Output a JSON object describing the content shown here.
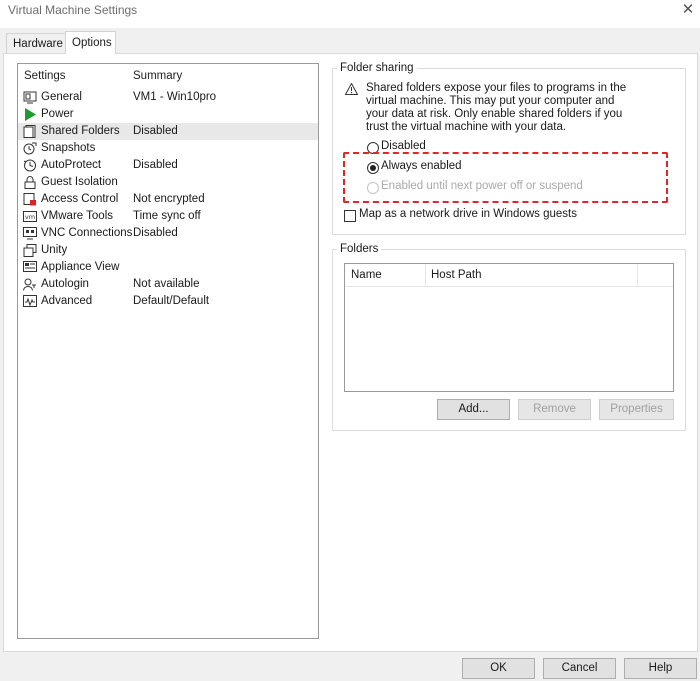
{
  "window": {
    "title": "Virtual Machine Settings"
  },
  "tabs": [
    {
      "label": "Hardware"
    },
    {
      "label": "Options"
    }
  ],
  "settings": {
    "header_settings": "Settings",
    "header_summary": "Summary",
    "items": [
      {
        "name": "General",
        "summary": "VM1 - Win10pro",
        "icon": "general-icon"
      },
      {
        "name": "Power",
        "summary": "",
        "icon": "power-icon"
      },
      {
        "name": "Shared Folders",
        "summary": "Disabled",
        "icon": "shared-folders-icon"
      },
      {
        "name": "Snapshots",
        "summary": "",
        "icon": "snapshots-icon"
      },
      {
        "name": "AutoProtect",
        "summary": "Disabled",
        "icon": "autoprotect-icon"
      },
      {
        "name": "Guest Isolation",
        "summary": "",
        "icon": "lock-icon"
      },
      {
        "name": "Access Control",
        "summary": "Not encrypted",
        "icon": "access-control-icon"
      },
      {
        "name": "VMware Tools",
        "summary": "Time sync off",
        "icon": "vmware-tools-icon"
      },
      {
        "name": "VNC Connections",
        "summary": "Disabled",
        "icon": "vnc-icon"
      },
      {
        "name": "Unity",
        "summary": "",
        "icon": "unity-icon"
      },
      {
        "name": "Appliance View",
        "summary": "",
        "icon": "appliance-view-icon"
      },
      {
        "name": "Autologin",
        "summary": "Not available",
        "icon": "autologin-icon"
      },
      {
        "name": "Advanced",
        "summary": "Default/Default",
        "icon": "advanced-icon"
      }
    ]
  },
  "folder_sharing": {
    "label": "Folder sharing",
    "warning_line1": "Shared folders expose your files to programs in the",
    "warning_line2": "virtual machine. This may put your computer and",
    "warning_line3": "your data at risk. Only enable shared folders if you",
    "warning_line4": "trust the virtual machine with your data.",
    "options": [
      {
        "label": "Disabled",
        "selected": false,
        "enabled": true
      },
      {
        "label": "Always enabled",
        "selected": true,
        "enabled": true
      },
      {
        "label": "Enabled until next power off or suspend",
        "selected": false,
        "enabled": false
      }
    ],
    "map_drive_label": "Map as a network drive in Windows guests",
    "map_drive_checked": false
  },
  "folders": {
    "label": "Folders",
    "col_name": "Name",
    "col_host_path": "Host Path",
    "add_label": "Add...",
    "remove_label": "Remove",
    "properties_label": "Properties"
  },
  "footer": {
    "ok_label": "OK",
    "cancel_label": "Cancel",
    "help_label": "Help"
  },
  "colors": {
    "highlight_border": "#e0262b",
    "selected_row": "#e8e8e8",
    "power_green": "#1f9a2e"
  }
}
